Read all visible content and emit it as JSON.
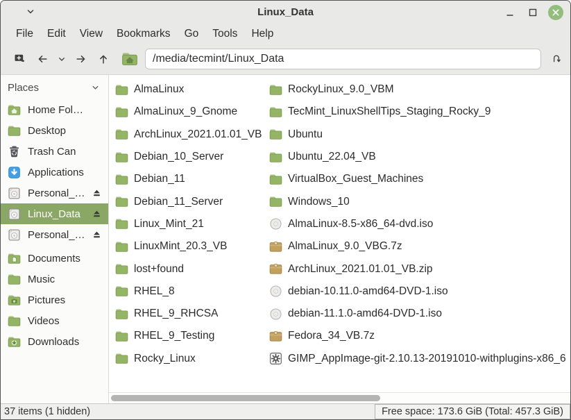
{
  "titlebar": {
    "title": "Linux_Data",
    "controls": [
      "minimize",
      "maximize",
      "close"
    ]
  },
  "menubar": {
    "items": [
      "File",
      "Edit",
      "View",
      "Bookmarks",
      "Go",
      "Tools",
      "Help"
    ]
  },
  "toolbar": {
    "path_value": "/media/tecmint/Linux_Data",
    "buttons": [
      "new-window",
      "back",
      "history-down",
      "forward",
      "up",
      "home-folder"
    ],
    "entry_toggle_icon": "u-turn-arrow"
  },
  "sidebar": {
    "header": "Places",
    "items": [
      {
        "label": "Home Fol…",
        "icon": "home-folder"
      },
      {
        "label": "Desktop",
        "icon": "folder"
      },
      {
        "label": "Trash Can",
        "icon": "trash"
      },
      {
        "label": "Applications",
        "icon": "applications"
      },
      {
        "label": "Personal_…",
        "icon": "drive",
        "ejectable": true
      },
      {
        "label": "Linux_Data",
        "icon": "drive",
        "ejectable": true,
        "selected": true
      },
      {
        "label": "Personal_…",
        "icon": "drive",
        "ejectable": true
      },
      {
        "label": "Documents",
        "icon": "folder-documents",
        "group_start": true
      },
      {
        "label": "Music",
        "icon": "folder"
      },
      {
        "label": "Pictures",
        "icon": "folder-pictures"
      },
      {
        "label": "Videos",
        "icon": "folder"
      },
      {
        "label": "Downloads",
        "icon": "folder-downloads"
      }
    ]
  },
  "files": {
    "columns": [
      [
        {
          "name": "AlmaLinux",
          "icon": "folder"
        },
        {
          "name": "AlmaLinux_9_Gnome",
          "icon": "folder"
        },
        {
          "name": "ArchLinux_2021.01.01_VB",
          "icon": "folder"
        },
        {
          "name": "Debian_10_Server",
          "icon": "folder"
        },
        {
          "name": "Debian_11",
          "icon": "folder"
        },
        {
          "name": "Debian_11_Server",
          "icon": "folder"
        },
        {
          "name": "Linux_Mint_21",
          "icon": "folder"
        },
        {
          "name": "LinuxMint_20.3_VB",
          "icon": "folder"
        },
        {
          "name": "lost+found",
          "icon": "folder"
        },
        {
          "name": "RHEL_8",
          "icon": "folder"
        },
        {
          "name": "RHEL_9_RHCSA",
          "icon": "folder"
        },
        {
          "name": "RHEL_9_Testing",
          "icon": "folder"
        },
        {
          "name": "Rocky_Linux",
          "icon": "folder"
        }
      ],
      [
        {
          "name": "RockyLinux_9.0_VBM",
          "icon": "folder"
        },
        {
          "name": "TecMint_LinuxShellTips_Staging_Rocky_9",
          "icon": "folder"
        },
        {
          "name": "Ubuntu",
          "icon": "folder"
        },
        {
          "name": "Ubuntu_22.04_VB",
          "icon": "folder"
        },
        {
          "name": "VirtualBox_Guest_Machines",
          "icon": "folder"
        },
        {
          "name": "Windows_10",
          "icon": "folder"
        },
        {
          "name": "AlmaLinux-8.5-x86_64-dvd.iso",
          "icon": "optical-disc"
        },
        {
          "name": "AlmaLinux_9.0_VBG.7z",
          "icon": "archive"
        },
        {
          "name": "ArchLinux_2021.01.01_VB.zip",
          "icon": "archive"
        },
        {
          "name": "debian-10.11.0-amd64-DVD-1.iso",
          "icon": "optical-disc"
        },
        {
          "name": "debian-11.1.0-amd64-DVD-1.iso",
          "icon": "optical-disc"
        },
        {
          "name": "Fedora_34_VB.7z",
          "icon": "archive"
        },
        {
          "name": "GIMP_AppImage-git-2.10.13-20191010-withplugins-x86_6",
          "icon": "appimage-gear"
        }
      ]
    ]
  },
  "statusbar": {
    "items_text": "37 items (1 hidden)",
    "free_space_text": "Free space: 173.6 GiB (Total: 457.3 GiB)"
  },
  "colors": {
    "selection_green": "#8aa766",
    "close_button_green": "#93bd7f",
    "folder_green": "#94b466",
    "archive_tan": "#c2a05f",
    "applications_blue": "#42a0e2",
    "chrome_gray": "#e9e9e7"
  }
}
